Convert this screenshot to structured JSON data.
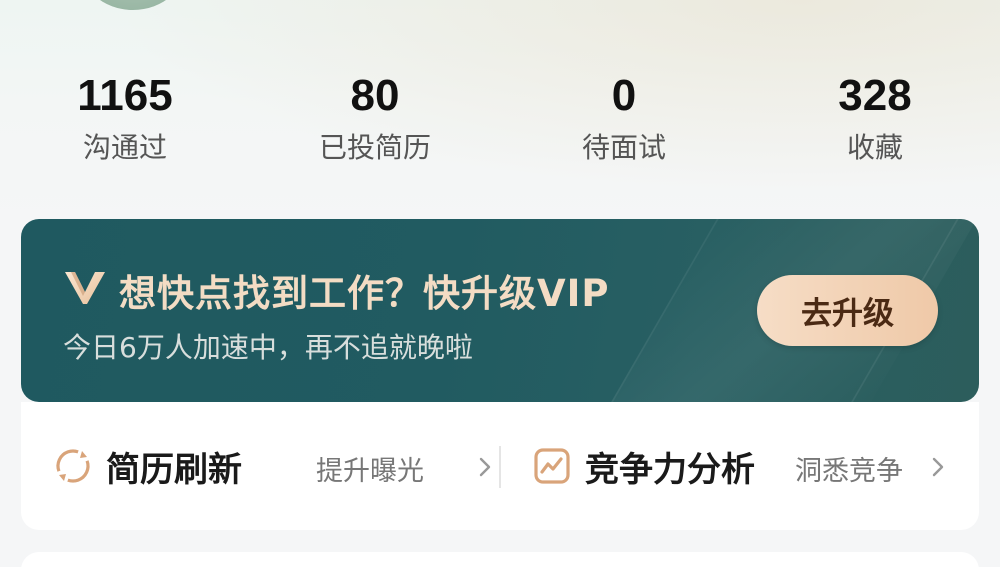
{
  "stats": [
    {
      "value": "1165",
      "label": "沟通过"
    },
    {
      "value": "80",
      "label": "已投简历"
    },
    {
      "value": "0",
      "label": "待面试"
    },
    {
      "value": "328",
      "label": "收藏"
    }
  ],
  "vip_banner": {
    "title": "想快点找到工作？快升级VIP",
    "subtitle": "今日6万人加速中，再不追就晚啦",
    "button_label": "去升级",
    "logo_icon": "vip-v-logo-icon",
    "accent_color": "#f3dcc4",
    "background_color": "#215b61"
  },
  "tools": [
    {
      "name": "简历刷新",
      "hint": "提升曝光",
      "icon": "refresh-icon"
    },
    {
      "name": "竞争力分析",
      "hint": "洞悉竞争",
      "icon": "trend-chart-icon"
    }
  ],
  "colors": {
    "icon_accent": "#d9a47a"
  }
}
